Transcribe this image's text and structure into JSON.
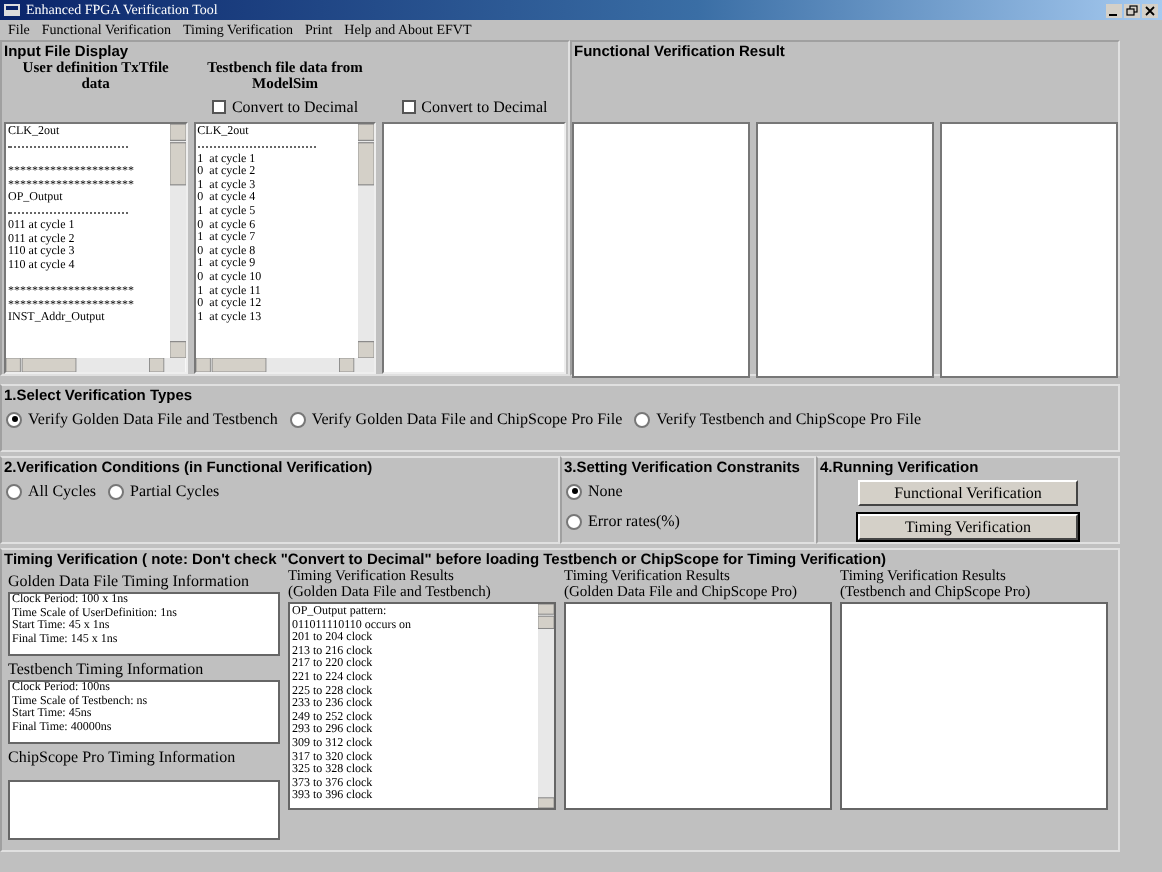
{
  "window": {
    "title": "Enhanced FPGA Verification Tool"
  },
  "menu": [
    "File",
    "Functional Verification",
    "Timing Verification",
    "Print",
    "Help and About EFVT"
  ],
  "input_file_display": {
    "title": "Input File Display",
    "columns": [
      {
        "header": "User definition TxTfile data",
        "lines": [
          {
            "kind": "text",
            "text": "CLK_2out"
          },
          {
            "kind": "rule"
          },
          {
            "kind": "blank"
          },
          {
            "kind": "text",
            "text": "*********************"
          },
          {
            "kind": "text",
            "text": "*********************"
          },
          {
            "kind": "text",
            "text": "OP_Output"
          },
          {
            "kind": "rule"
          },
          {
            "kind": "text",
            "text": "011 at cycle 1"
          },
          {
            "kind": "text",
            "text": "011 at cycle 2"
          },
          {
            "kind": "text",
            "text": "110 at cycle 3"
          },
          {
            "kind": "text",
            "text": "110 at cycle 4"
          },
          {
            "kind": "blank"
          },
          {
            "kind": "text",
            "text": "*********************"
          },
          {
            "kind": "text",
            "text": "*********************"
          },
          {
            "kind": "text",
            "text": "INST_Addr_Output"
          }
        ]
      },
      {
        "header": "Testbench file data from ModelSim",
        "convert": {
          "label": "Convert to Decimal",
          "checked": false
        },
        "lines": [
          {
            "kind": "text",
            "text": "CLK_2out"
          },
          {
            "kind": "rule"
          }
        ],
        "more_lines": [
          "1  at cycle 1",
          "0  at cycle 2",
          "1  at cycle 3",
          "0  at cycle 4",
          "1  at cycle 5",
          "0  at cycle 6",
          "1  at cycle 7",
          "0  at cycle 8",
          "1  at cycle 9",
          "0  at cycle 10",
          "1  at cycle 11",
          "0  at cycle 12",
          "1  at cycle 13"
        ]
      },
      {
        "convert": {
          "label": "Convert to Decimal",
          "checked": false
        }
      }
    ]
  },
  "functional_result": {
    "title": "Functional Verification Result"
  },
  "verification_types": {
    "title": "1.Select Verification Types",
    "options": [
      {
        "label": "Verify Golden Data File and Testbench",
        "selected": true
      },
      {
        "label": "Verify Golden Data File and ChipScope Pro File",
        "selected": false
      },
      {
        "label": "Verify Testbench and ChipScope Pro File",
        "selected": false
      }
    ]
  },
  "conditions": {
    "title": "2.Verification Conditions (in Functional Verification)",
    "options": [
      {
        "label": "All Cycles",
        "selected": false
      },
      {
        "label": "Partial Cycles",
        "selected": false
      }
    ]
  },
  "constraints": {
    "title": "3.Setting Verification Constranits",
    "options": [
      {
        "label": "None",
        "selected": true
      },
      {
        "label": "Error rates(%)",
        "selected": false
      }
    ]
  },
  "running": {
    "title": "4.Running Verification",
    "buttons": [
      {
        "label": "Functional Verification",
        "focused": false
      },
      {
        "label": "Timing Verification",
        "focused": true
      }
    ]
  },
  "timing": {
    "title": "Timing Verification ( note: Don't check \"Convert to Decimal\" before loading Testbench or ChipScope for Timing Verification)",
    "info": [
      {
        "label": "Golden Data File Timing Information",
        "lines": [
          "Clock Period: 100 x 1ns",
          "Time Scale of UserDefinition: 1ns",
          "Start Time: 45 x 1ns",
          "Final Time: 145 x 1ns"
        ]
      },
      {
        "label": "Testbench Timing Information",
        "lines": [
          "Clock Period: 100ns",
          "Time Scale of Testbench: ns",
          "Start Time: 45ns",
          "Final Time: 40000ns"
        ]
      },
      {
        "label": "ChipScope Pro Timing Information"
      }
    ],
    "results": [
      {
        "title": "Timing Verification Results",
        "subtitle": "(Golden Data File and Testbench)",
        "lines": [
          "OP_Output pattern:",
          "011011110110 occurs on",
          "201 to 204 clock",
          "213 to 216 clock",
          "217 to 220 clock",
          "221 to 224 clock",
          "225 to 228 clock",
          "233 to 236 clock",
          "249 to 252 clock",
          "293 to 296 clock",
          "309 to 312 clock",
          "317 to 320 clock",
          "325 to 328 clock",
          "373 to 376 clock",
          "393 to 396 clock"
        ]
      },
      {
        "title": "Timing Verification Results",
        "subtitle": "(Golden Data File and ChipScope Pro)"
      },
      {
        "title": "Timing Verification Results",
        "subtitle": "(Testbench and ChipScope Pro)"
      }
    ]
  }
}
